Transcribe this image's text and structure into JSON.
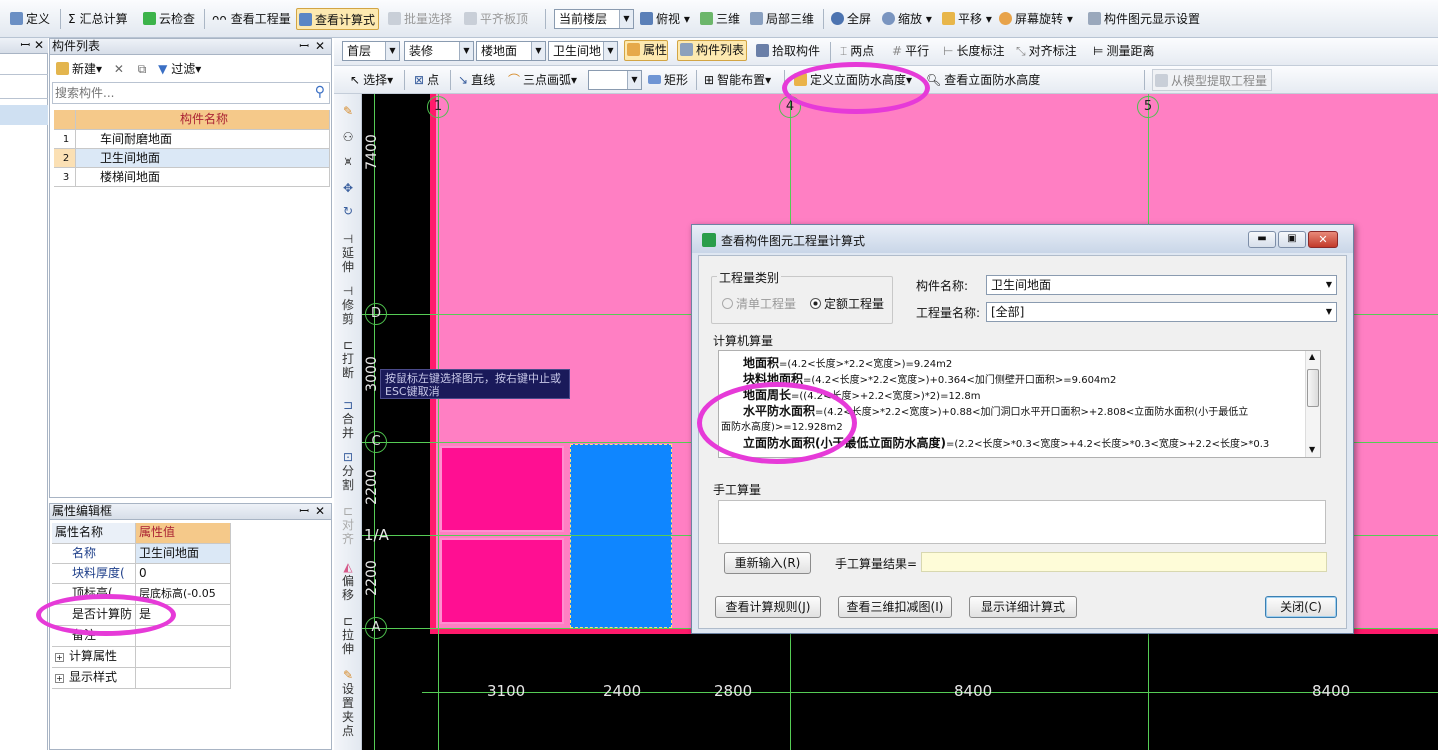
{
  "toolbar1": {
    "items": [
      "定义",
      "汇总计算",
      "云检查",
      "查看工程量",
      "查看计算式",
      "批量选择",
      "平齐板顶"
    ],
    "floor_combo": "当前楼层",
    "view_items": [
      "俯视",
      "三维",
      "局部三维",
      "全屏",
      "缩放",
      "平移",
      "屏幕旋转",
      "构件图元显示设置"
    ]
  },
  "toolbar2": {
    "floor": "首层",
    "category": "装修",
    "type": "楼地面",
    "element": "卫生间地",
    "buttons": [
      "属性",
      "构件列表",
      "拾取构件",
      "两点",
      "平行",
      "长度标注",
      "对齐标注",
      "测量距离"
    ]
  },
  "toolbar3": {
    "items": [
      "选择",
      "点",
      "直线",
      "三点画弧",
      "矩形",
      "智能布置",
      "定义立面防水高度",
      "查看立面防水高度",
      "从模型提取工程量"
    ]
  },
  "component_panel": {
    "title": "构件列表",
    "new_label": "新建",
    "filter_label": "过滤",
    "search_placeholder": "搜索构件...",
    "header": "构件名称",
    "rows": [
      {
        "num": "1",
        "name": "车间耐磨地面"
      },
      {
        "num": "2",
        "name": "卫生间地面"
      },
      {
        "num": "3",
        "name": "楼梯间地面"
      }
    ]
  },
  "prop_panel": {
    "title": "属性编辑框",
    "col_name": "属性名称",
    "col_value": "属性值",
    "rows": [
      {
        "name": "名称",
        "value": "卫生间地面"
      },
      {
        "name": "块料厚度(",
        "value": "0"
      },
      {
        "name": "顶标高(",
        "value": "层底标高(-0.05"
      },
      {
        "name": "是否计算防",
        "value": "是"
      },
      {
        "name": "备注",
        "value": ""
      },
      {
        "name": "计算属性",
        "value": ""
      },
      {
        "name": "显示样式",
        "value": ""
      }
    ]
  },
  "side_tools": [
    "延伸",
    "修剪",
    "打断",
    "合并",
    "分割",
    "对齐",
    "偏移",
    "拉伸",
    "设置夹点"
  ],
  "canvas": {
    "axes_top": [
      "1",
      "4",
      "5"
    ],
    "axes_left": [
      "D",
      "C",
      "1/A",
      "A"
    ],
    "dims_left": [
      "7400",
      "3000",
      "2200",
      "2200"
    ],
    "dims_bottom": [
      "3100",
      "2400",
      "2800",
      "8400",
      "8400"
    ],
    "tooltip": "按鼠标左键选择图元，按右键中止或ESC键取消",
    "colors": {
      "floor": "#ff7fc3",
      "room": "#ff0f92",
      "selected": "#0f86ff",
      "background": "#000000",
      "grid": "#55cc55"
    }
  },
  "dialog": {
    "title": "查看构件图元工程量计算式",
    "type_group": "工程量类别",
    "radio_list": "清单工程量",
    "radio_quota": "定额工程量",
    "comp_label": "构件名称:",
    "comp_value": "卫生间地面",
    "qty_label": "工程量名称:",
    "qty_value": "[全部]",
    "computer_group": "计算机算量",
    "formulas": [
      {
        "name": "地面积",
        "expr": "=(4.2<长度>*2.2<宽度>)=9.24m2"
      },
      {
        "name": "块料地面积",
        "expr": "=(4.2<长度>*2.2<宽度>)+0.364<加门侧壁开口面积>=9.604m2"
      },
      {
        "name": "地面周长",
        "expr": "=((4.2<长度>+2.2<宽度>)*2)=12.8m"
      },
      {
        "name": "水平防水面积",
        "expr": "=(4.2<长度>*2.2<宽度>)+0.88<加门洞口水平开口面积>+2.808<立面防水面积(小于最低立"
      },
      {
        "name": "",
        "expr": "面防水高度)>=12.928m2"
      },
      {
        "name": "立面防水面积(小于最低立面防水高度)",
        "expr": "=(2.2<长度>*0.3<宽度>+4.2<长度>*0.3<宽度>+2.2<长度>*0.3"
      }
    ],
    "manual_group": "手工算量",
    "reenter_btn": "重新输入(R)",
    "manual_result_label": "手工算量结果=",
    "rule_btn": "查看计算规则(J)",
    "deduct_btn": "查看三维扣减图(I)",
    "detail_btn": "显示详细计算式",
    "close_btn": "关闭(C)"
  }
}
